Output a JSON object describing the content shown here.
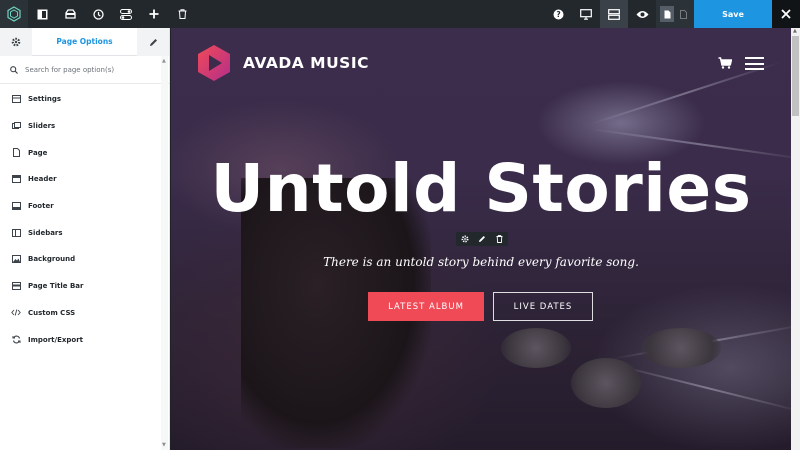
{
  "toolbar": {
    "save_label": "Save",
    "icons": [
      "avada-logo-icon",
      "sidebar-toggle-icon",
      "library-icon",
      "history-icon",
      "toggle-icon",
      "add-icon",
      "trash-icon",
      "help-icon",
      "desktop-icon",
      "wireframe-icon",
      "preview-icon",
      "page-icon",
      "post-icon",
      "close-icon"
    ]
  },
  "sidebar": {
    "tab_label": "Page Options",
    "search_placeholder": "Search for page option(s)",
    "items": [
      {
        "label": "Settings",
        "icon": "settings-icon"
      },
      {
        "label": "Sliders",
        "icon": "sliders-icon"
      },
      {
        "label": "Page",
        "icon": "page-icon"
      },
      {
        "label": "Header",
        "icon": "header-icon"
      },
      {
        "label": "Footer",
        "icon": "footer-icon"
      },
      {
        "label": "Sidebars",
        "icon": "sidebars-icon"
      },
      {
        "label": "Background",
        "icon": "background-icon"
      },
      {
        "label": "Page Title Bar",
        "icon": "page-title-bar-icon"
      },
      {
        "label": "Custom CSS",
        "icon": "code-icon"
      },
      {
        "label": "Import/Export",
        "icon": "import-export-icon"
      }
    ]
  },
  "preview": {
    "brand_name": "AVADA MUSIC",
    "hero_title": "Untold Stories",
    "hero_subtitle": "There is an untold story behind every favorite song.",
    "primary_button": "LATEST ALBUM",
    "secondary_button": "LIVE DATES"
  },
  "colors": {
    "accent_blue": "#1d95e0",
    "brand_red": "#f04a57",
    "toolbar_bg": "#23282d"
  }
}
